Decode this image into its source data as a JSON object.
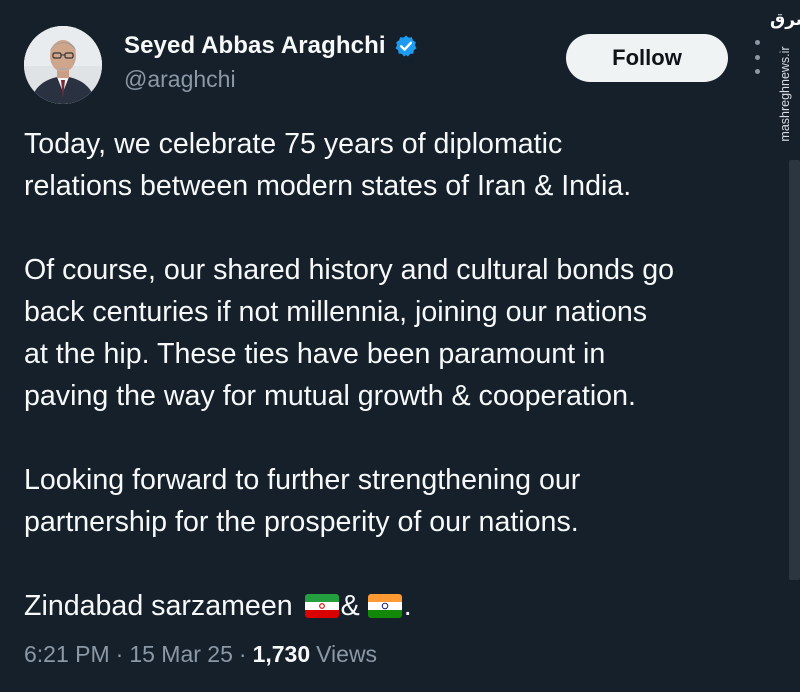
{
  "author": {
    "display_name": "Seyed Abbas Araghchi",
    "handle": "@araghchi",
    "verified": true,
    "verified_color": "#1d9bf0"
  },
  "follow_button": {
    "label": "Follow"
  },
  "tweet": {
    "lines_p1": [
      "Today, we celebrate 75 years of diplomatic",
      "relations between modern states of Iran & India."
    ],
    "lines_p2": [
      "Of course, our shared history and cultural bonds go",
      "back centuries if not millennia, joining our nations",
      "at the hip. These ties have been paramount in",
      "paving the way for mutual growth & cooperation."
    ],
    "lines_p3": [
      "Looking forward to further strengthening our",
      "partnership for the prosperity of our nations."
    ],
    "closing": {
      "text": "Zindabad sarzameen",
      "joiner": "&",
      "end": ".",
      "flags": [
        "iran-flag",
        "india-flag"
      ]
    }
  },
  "meta": {
    "time": "6:21 PM",
    "date": "15 Mar 25",
    "separator": "·",
    "views_count": "1,730",
    "views_label": "Views"
  },
  "watermark": {
    "logo_text": "مشرق",
    "site": "mashreghnews.ir"
  },
  "colors": {
    "background": "#15202b",
    "text_primary": "#f7f9f9",
    "text_secondary": "#8b98a5",
    "follow_bg": "#eff3f4",
    "follow_text": "#0f1419"
  },
  "icons": [
    "verified-badge-icon",
    "more-options-icon",
    "iran-flag",
    "india-flag"
  ]
}
